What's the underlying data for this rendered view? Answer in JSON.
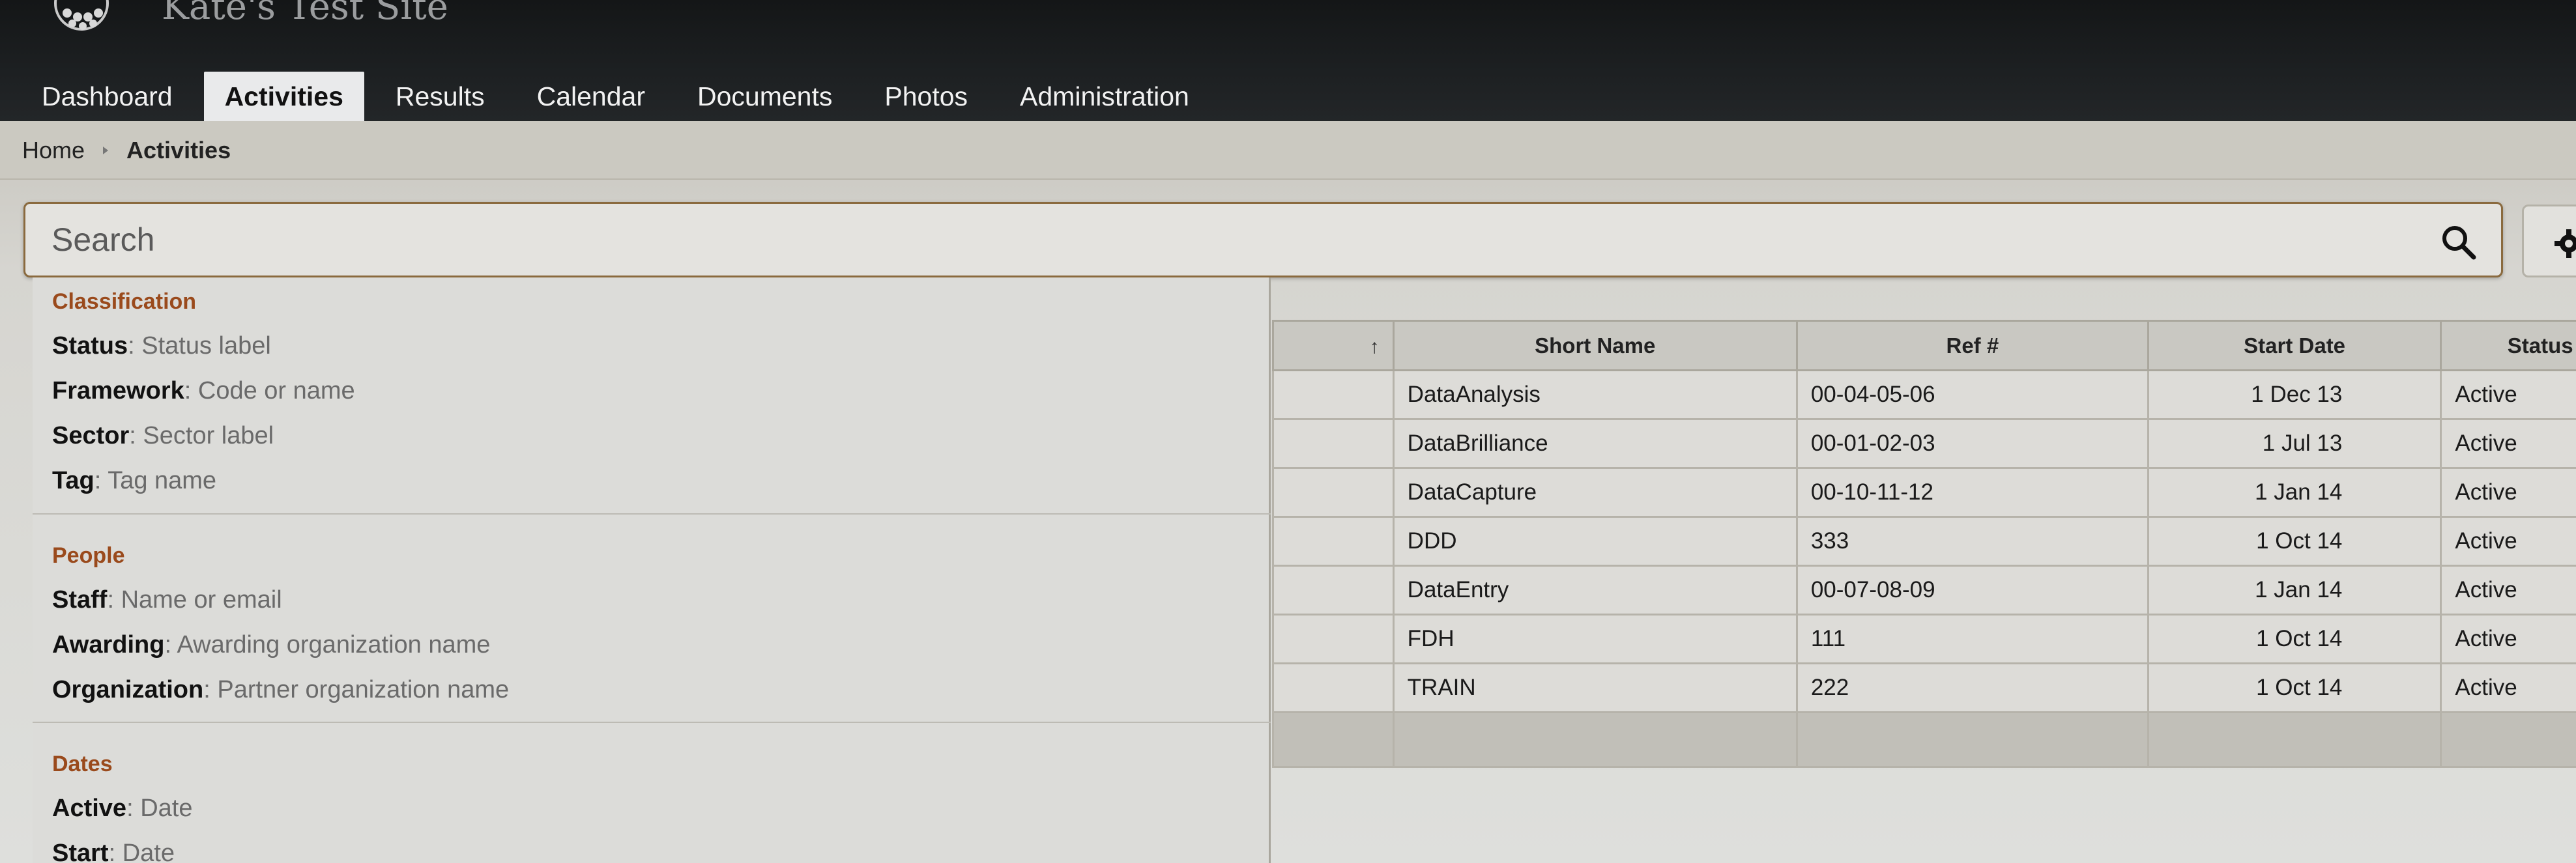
{
  "header": {
    "site_title": "Kate's Test Site",
    "tabs": [
      {
        "label": "Dashboard",
        "active": false
      },
      {
        "label": "Activities",
        "active": true
      },
      {
        "label": "Results",
        "active": false
      },
      {
        "label": "Calendar",
        "active": false
      },
      {
        "label": "Documents",
        "active": false
      },
      {
        "label": "Photos",
        "active": false
      },
      {
        "label": "Administration",
        "active": false
      }
    ]
  },
  "breadcrumb": {
    "home": "Home",
    "current": "Activities"
  },
  "search": {
    "placeholder": "Search",
    "value": ""
  },
  "filters": {
    "classification": {
      "title": "Classification",
      "rows": [
        {
          "key": "Status",
          "hint": "Status label"
        },
        {
          "key": "Framework",
          "hint": "Code or name"
        },
        {
          "key": "Sector",
          "hint": "Sector label"
        },
        {
          "key": "Tag",
          "hint": "Tag name"
        }
      ]
    },
    "people": {
      "title": "People",
      "rows": [
        {
          "key": "Staff",
          "hint": "Name or email"
        },
        {
          "key": "Awarding",
          "hint": "Awarding organization name"
        },
        {
          "key": "Organization",
          "hint": "Partner organization name"
        }
      ]
    },
    "dates": {
      "title": "Dates",
      "rows": [
        {
          "key": "Active",
          "hint": "Date"
        },
        {
          "key": "Start",
          "hint": "Date"
        }
      ]
    }
  },
  "table": {
    "columns": [
      "Short Name",
      "Ref #",
      "Start Date",
      "Status"
    ],
    "rows": [
      {
        "name": "DataAnalysis",
        "ref": "00-04-05-06",
        "start": "1 Dec 13",
        "status": "Active"
      },
      {
        "name": "DataBrilliance",
        "ref": "00-01-02-03",
        "start": "1 Jul 13",
        "status": "Active"
      },
      {
        "name": "DataCapture",
        "ref": "00-10-11-12",
        "start": "1 Jan 14",
        "status": "Active"
      },
      {
        "name": "DDD",
        "ref": "333",
        "start": "1 Oct 14",
        "status": "Active"
      },
      {
        "name": "DataEntry",
        "ref": "00-07-08-09",
        "start": "1 Jan 14",
        "status": "Active"
      },
      {
        "name": "FDH",
        "ref": "111",
        "start": "1 Oct 14",
        "status": "Active"
      },
      {
        "name": "TRAIN",
        "ref": "222",
        "start": "1 Oct 14",
        "status": "Active"
      }
    ]
  },
  "icons": {
    "search": "search-icon",
    "settings": "gear-icon",
    "sort": "sort-up-icon",
    "logo": "logo-icon",
    "breadcrumb_sep": "chevron-right-icon"
  }
}
